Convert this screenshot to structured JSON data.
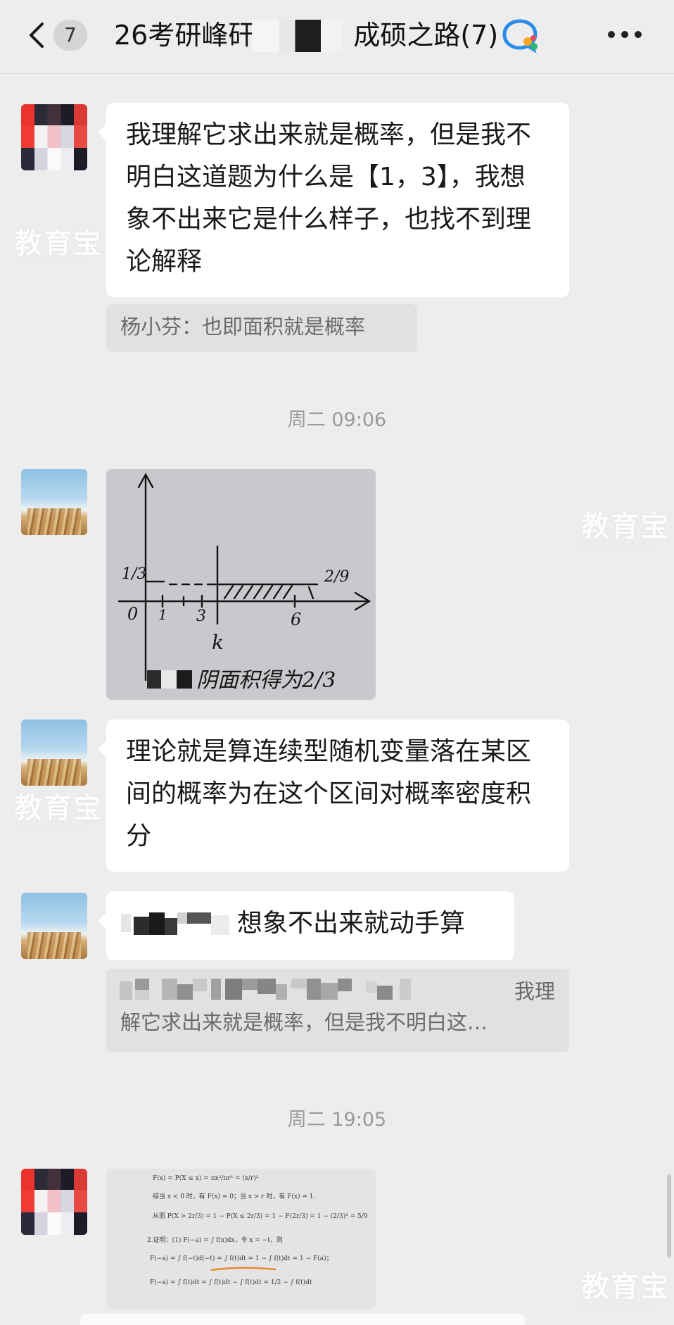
{
  "header": {
    "unread_count": "7",
    "title_left": "26考研峰矸",
    "title_right": "成硕之路(7)"
  },
  "messages": {
    "m1_text": "我理解它求出来就是概率，但是我不明白这道题为什么是【1，3】，我想象不出来它是什么样子，也找不到理论解释",
    "m1_quote": "杨小芬：也即面积就是概率",
    "time1": "周二 09:06",
    "sketch": {
      "y_tick": "1/3",
      "x_ticks": [
        "0",
        "1",
        "3",
        "6"
      ],
      "k_label": "k",
      "right_label": "2/9",
      "caption": "阴面积得为2/3"
    },
    "m3_text": "理论就是算连续型随机变量落在某区间的概率为在这个区间对概率密度积分",
    "m4_text": "想象不出来就动手算",
    "m4_quote_line1": "我理",
    "m4_quote_line2": "解它求出来就是概率，但是我不明白这…",
    "time2": "周二 19:05",
    "doc_lines": [
      "F(x) = P(X ≤ x) = πx²/πr² = (x/r)²",
      "综当 x < 0 时，有 F(x) = 0；当 x > r 时，有 F(x) = 1.",
      "从而 P(X > 2r/3) = 1 − P(X ≤ 2r/3) = 1 − F(2r/3) = 1 − (2/3)² = 5/9",
      "2.证明：(1) F(−a) = ∫ f(x)dx，令 x = −t，则",
      "F(−a) = ∫ f(−t)d(−t) = ∫ f(t)dt = 1 − ∫ f(t)dt = 1 − F(a)；",
      "F(−a) = ∫ f(t)dt = ∫ f(t)dt − ∫ f(t)dt = 1/2 − ∫ f(t)dt"
    ]
  },
  "watermark": {
    "brand": "教育宝",
    "domain": "JIAOYUBAO.CN"
  }
}
